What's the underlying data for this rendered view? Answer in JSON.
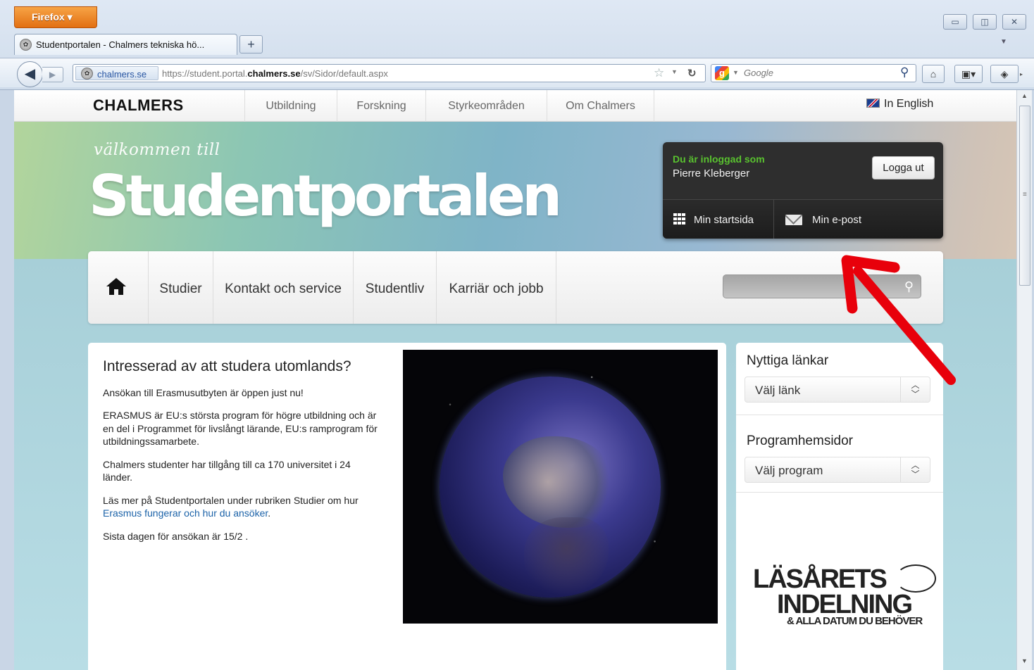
{
  "browser": {
    "menu_button": "Firefox ▾",
    "tab_title": "Studentportalen - Chalmers tekniska hö...",
    "new_tab": "+",
    "site_identity": "chalmers.se",
    "url_prefix": "https://student.portal.",
    "url_domain": "chalmers.se",
    "url_suffix": "/sv/Sidor/default.aspx",
    "search_engine_placeholder": "Google",
    "window_controls": [
      "▭",
      "◫",
      "✕"
    ]
  },
  "site_nav": {
    "logo": "CHALMERS",
    "items": [
      "Utbildning",
      "Forskning",
      "Styrkeområden",
      "Om Chalmers"
    ],
    "language": "In English"
  },
  "hero": {
    "welcome": "välkommen till",
    "title": "Studentportalen"
  },
  "login": {
    "label": "Du är inloggad som",
    "user": "Pierre Kleberger",
    "logout": "Logga ut",
    "start_link": "Min startsida",
    "mail_link": "Min e-post"
  },
  "main_nav": {
    "items": [
      "Studier",
      "Kontakt och service",
      "Studentliv",
      "Karriär och jobb"
    ],
    "search_placeholder": ""
  },
  "content": {
    "heading": "Intresserad av att studera utomlands?",
    "p1": "Ansökan till Erasmusutbyten är öppen just nu!",
    "p2": "ERASMUS är EU:s största program för högre utbildning och är en del i Programmet för livslångt lärande, EU:s ramprogram för utbildningssamarbete.",
    "p3": "Chalmers studenter har tillgång till ca 170 universitet i 24 länder.",
    "p4_before": "Läs mer på Studentportalen under rubriken Studier om hur ",
    "p4_link": "Erasmus fungerar och hur du ansöker",
    "p4_after": ".",
    "p5": "Sista dagen för ansökan är 15/2 ."
  },
  "sidebar": {
    "links_heading": "Nyttiga länkar",
    "links_select": "Välj länk",
    "programs_heading": "Programhemsidor",
    "programs_select": "Välj program",
    "banner_line1": "LÄSÅRETS",
    "banner_line2": "INDELNING",
    "banner_line3": "& ALLA DATUM DU BEHÖVER"
  },
  "colors": {
    "login_label": "#59c22f",
    "link": "#1b62a8",
    "annotation_arrow": "#e8000b"
  }
}
